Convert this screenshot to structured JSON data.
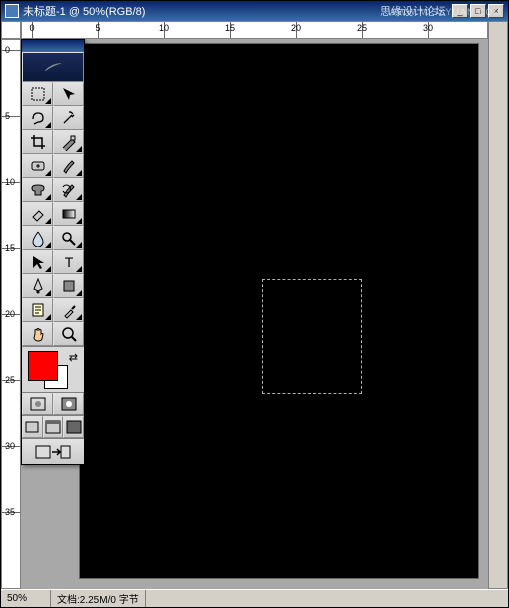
{
  "title": "未标题-1 @ 50%(RGB/8)",
  "watermark_forum": "思缘设计论坛",
  "watermark_url": "WWW.MISSYUAN.COM",
  "window_buttons": {
    "min": "_",
    "max": "□",
    "close": "×"
  },
  "ruler": {
    "h_marks": [
      0,
      5,
      10,
      15,
      20,
      25,
      30
    ],
    "v_marks": [
      0,
      5,
      10,
      15,
      20,
      25,
      30,
      35
    ]
  },
  "statusbar": {
    "zoom": "50%",
    "docinfo": "文档:2.25M/0 字节"
  },
  "colors": {
    "fg": "#ff0000",
    "bg": "#ffffff"
  },
  "tools": [
    {
      "name": "marquee-tool",
      "sub": true
    },
    {
      "name": "move-tool",
      "sub": false
    },
    {
      "name": "lasso-tool",
      "sub": true
    },
    {
      "name": "magic-wand-tool",
      "sub": false
    },
    {
      "name": "crop-tool",
      "sub": false
    },
    {
      "name": "slice-tool",
      "sub": true
    },
    {
      "name": "healing-brush-tool",
      "sub": true
    },
    {
      "name": "brush-tool",
      "sub": true
    },
    {
      "name": "stamp-tool",
      "sub": true
    },
    {
      "name": "history-brush-tool",
      "sub": true
    },
    {
      "name": "eraser-tool",
      "sub": true
    },
    {
      "name": "gradient-tool",
      "sub": true
    },
    {
      "name": "blur-tool",
      "sub": true
    },
    {
      "name": "dodge-tool",
      "sub": true
    },
    {
      "name": "path-selection-tool",
      "sub": true
    },
    {
      "name": "type-tool",
      "sub": true
    },
    {
      "name": "pen-tool",
      "sub": true
    },
    {
      "name": "shape-tool",
      "sub": true
    },
    {
      "name": "notes-tool",
      "sub": true
    },
    {
      "name": "eyedropper-tool",
      "sub": true
    },
    {
      "name": "hand-tool",
      "sub": false
    },
    {
      "name": "zoom-tool",
      "sub": false
    }
  ]
}
